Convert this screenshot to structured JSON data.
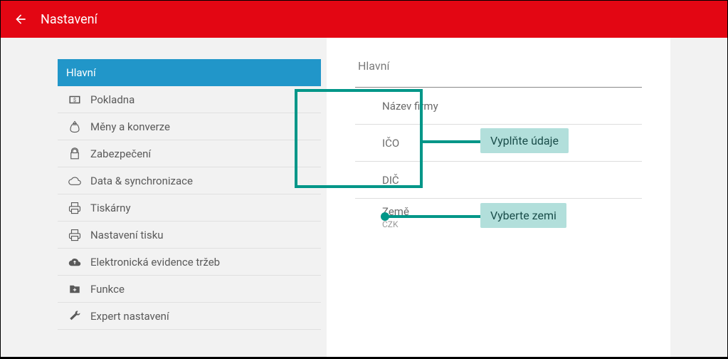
{
  "header": {
    "title": "Nastavení"
  },
  "sidebar": {
    "items": [
      {
        "label": "Hlavní",
        "active": true
      },
      {
        "label": "Pokladna"
      },
      {
        "label": "Měny a konverze"
      },
      {
        "label": "Zabezpečení"
      },
      {
        "label": "Data & synchronizace"
      },
      {
        "label": "Tiskárny"
      },
      {
        "label": "Nastavení tisku"
      },
      {
        "label": "Elektronická evidence tržeb"
      },
      {
        "label": "Funkce"
      },
      {
        "label": "Expert nastavení"
      }
    ]
  },
  "panel": {
    "title": "Hlavní",
    "fields": {
      "company_name": "Název firmy",
      "ico": "IČO",
      "dic": "DIČ",
      "country_label": "Země",
      "country_value": "CZK"
    }
  },
  "callouts": {
    "fill_data": "Vyplňte údaje",
    "select_country": "Vyberte zemi"
  }
}
